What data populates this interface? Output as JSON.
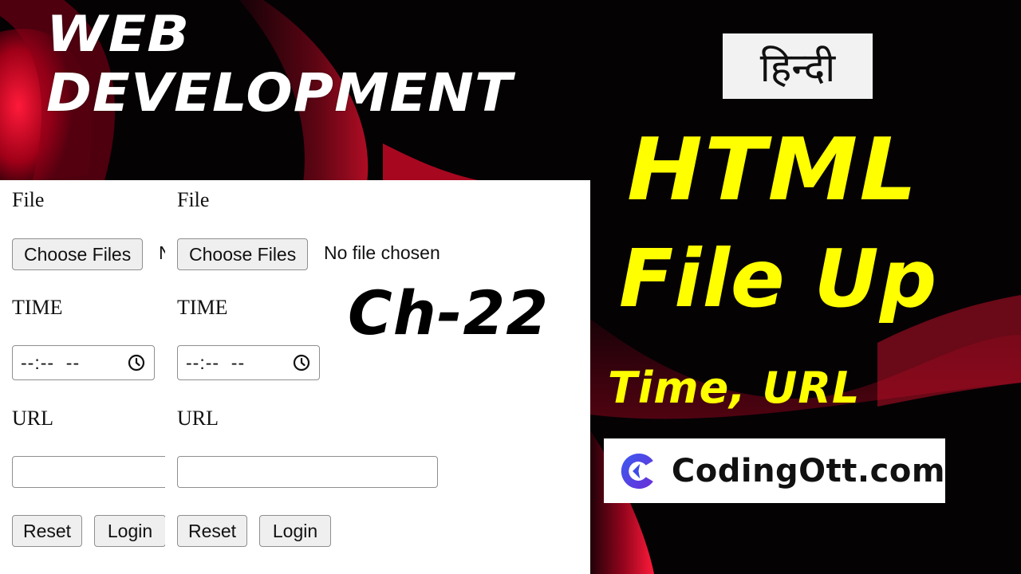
{
  "headline": {
    "line1": "WEB",
    "line2": "DEVELOPMENT"
  },
  "badge": {
    "language": "हिन्दी"
  },
  "title": {
    "line1": "HTML",
    "line2": "File Up",
    "line3": "Time, URL"
  },
  "chapter": "Ch-22",
  "brand": {
    "name": "CodingOtt.com",
    "logo_icon": "coding-ott-logo-icon",
    "logo_color": "#4a3fe0"
  },
  "form_demo": {
    "columns": [
      {
        "file_label": "File",
        "choose_button": "Choose Files",
        "file_status": "No file chosen",
        "time_label": "TIME",
        "time_value": "--:--  --",
        "time_icon": "clock-icon",
        "url_label": "URL",
        "url_value": "",
        "reset_button": "Reset",
        "login_button": "Login"
      },
      {
        "file_label": "File",
        "choose_button": "Choose Files",
        "file_status": "No file chosen",
        "time_label": "TIME",
        "time_value": "--:--  --",
        "time_icon": "clock-icon",
        "url_label": "URL",
        "url_value": "",
        "reset_button": "Reset",
        "login_button": "Login"
      }
    ]
  },
  "colors": {
    "title_yellow": "#ffff00",
    "accent_red": "#e0102a",
    "background": "#050204"
  }
}
